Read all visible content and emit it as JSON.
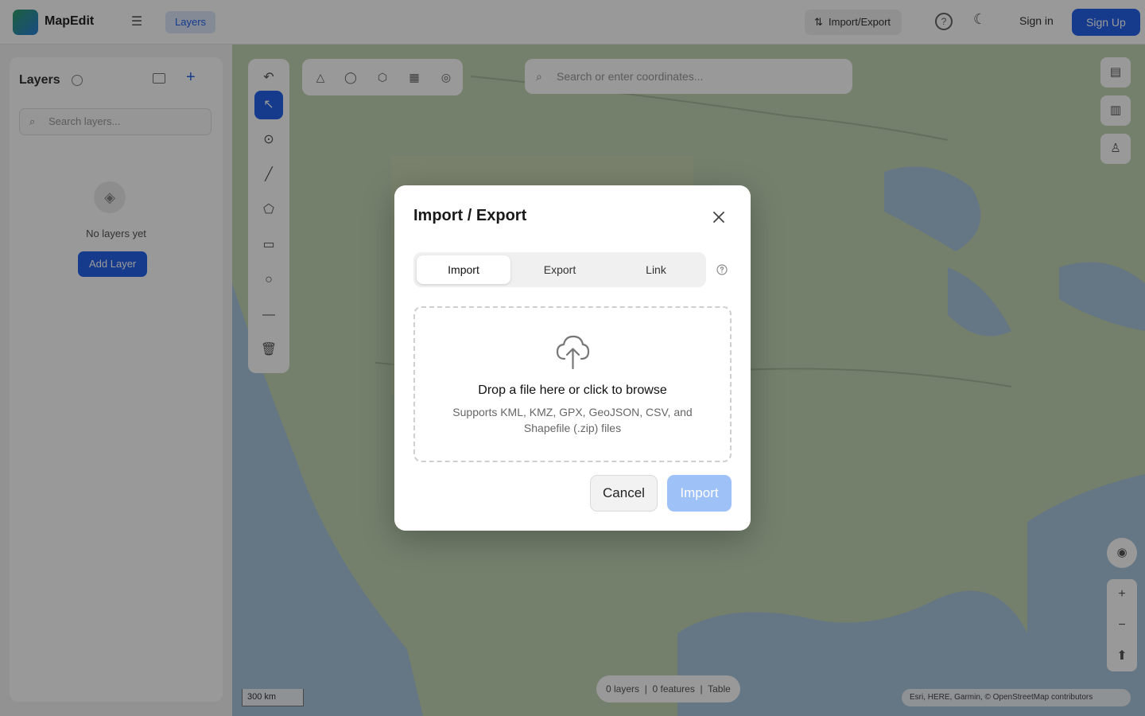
{
  "app": {
    "name": "MapEdit"
  },
  "topbar": {
    "menu_icon": "menu-icon",
    "layers_tab": "Layers",
    "import_export_button": "Import/Export",
    "sign_in": "Sign in",
    "sign_up": "Sign Up"
  },
  "sidebar": {
    "title": "Layers",
    "search_placeholder": "Search layers...",
    "empty_text": "No layers yet",
    "add_layer_button": "Add Layer"
  },
  "map": {
    "search_placeholder": "Search or enter coordinates...",
    "stats": [
      "0 layers",
      "0 features",
      "Table"
    ],
    "scale_label": "300 km",
    "attribution": "Esri, HERE, Garmin, © OpenStreetMap contributors"
  },
  "dialog": {
    "title": "Import / Export",
    "tabs": [
      {
        "label": "Import",
        "active": true
      },
      {
        "label": "Export",
        "active": false
      },
      {
        "label": "Link",
        "active": false
      }
    ],
    "drop_title": "Drop a file here or click to browse",
    "drop_subtitle": "Supports KML, KMZ, GPX, GeoJSON, CSV, and Shapefile (.zip) files",
    "cancel_button": "Cancel",
    "import_button": "Import",
    "import_enabled": false
  },
  "colors": {
    "accent": "#2563eb",
    "import_disabled": "#9ec1f7",
    "overlay": "rgba(0,0,0,0.4)"
  }
}
